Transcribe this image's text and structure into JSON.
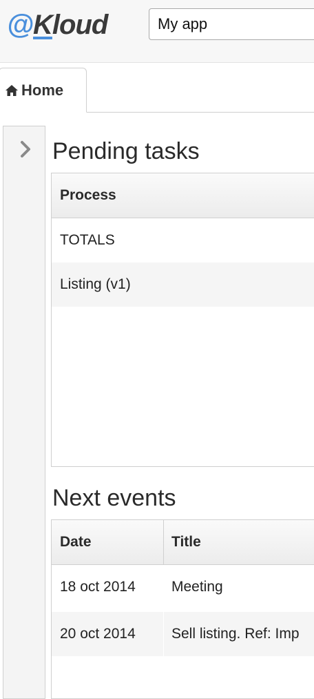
{
  "header": {
    "logo": {
      "at": "@",
      "k": "K",
      "rest": "loud"
    },
    "app_select": {
      "value": "My app"
    }
  },
  "tabs": [
    {
      "label": "Home",
      "icon": "home-icon",
      "active": true
    }
  ],
  "sidebar": {
    "toggle_icon": "chevron-right-icon"
  },
  "pending_tasks": {
    "title": "Pending tasks",
    "columns": [
      "Process"
    ],
    "rows": [
      {
        "process": "TOTALS"
      },
      {
        "process": "Listing (v1)"
      }
    ]
  },
  "next_events": {
    "title": "Next events",
    "columns": [
      "Date",
      "Title"
    ],
    "rows": [
      {
        "date": "18 oct 2014",
        "title": "Meeting"
      },
      {
        "date": "20 oct 2014",
        "title": "Sell listing. Ref: Imp"
      }
    ]
  },
  "colors": {
    "brand_blue": "#4a8fdc",
    "brand_dark": "#3a3a3a"
  }
}
